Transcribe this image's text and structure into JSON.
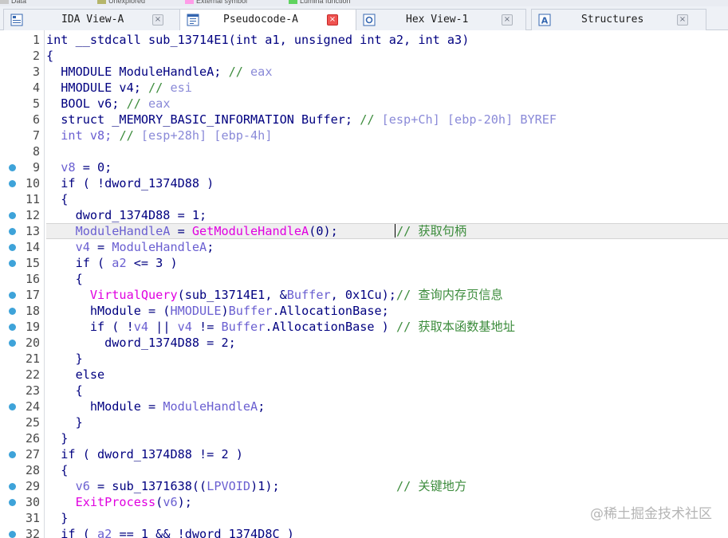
{
  "legend": [
    {
      "label": "Data",
      "color": "#c8c8c8"
    },
    {
      "label": "Unexplored",
      "color": "#b5b56a"
    },
    {
      "label": "External symbol",
      "color": "#ff9ce8"
    },
    {
      "label": "Lumina function",
      "color": "#5fd35f"
    }
  ],
  "tabs": [
    {
      "label": "IDA View-A",
      "icon": "graph-view-icon",
      "close": "×",
      "active": false
    },
    {
      "label": "Pseudocode-A",
      "icon": "pseudocode-icon",
      "close": "×",
      "active": true
    },
    {
      "label": "Hex View-1",
      "icon": "hex-view-icon",
      "close": "×",
      "active": false
    },
    {
      "label": "Structures",
      "icon": "structures-icon",
      "close": "×",
      "active": false
    }
  ],
  "code": [
    {
      "num": "1",
      "bp": false,
      "parts": [
        [
          "k",
          "int __stdcall sub_13714E1(int a1, unsigned int a2, int a3)"
        ]
      ]
    },
    {
      "num": "2",
      "bp": false,
      "parts": [
        [
          "k",
          "{"
        ]
      ]
    },
    {
      "num": "3",
      "bp": false,
      "parts": [
        [
          "k",
          "  HMODULE ModuleHandleA; "
        ],
        [
          "c",
          "// "
        ],
        [
          "cg",
          "eax"
        ]
      ]
    },
    {
      "num": "4",
      "bp": false,
      "parts": [
        [
          "k",
          "  HMODULE v4; "
        ],
        [
          "c",
          "// "
        ],
        [
          "cg",
          "esi"
        ]
      ]
    },
    {
      "num": "5",
      "bp": false,
      "parts": [
        [
          "k",
          "  BOOL v6; "
        ],
        [
          "c",
          "// "
        ],
        [
          "cg",
          "eax"
        ]
      ]
    },
    {
      "num": "6",
      "bp": false,
      "parts": [
        [
          "k",
          "  struct _MEMORY_BASIC_INFORMATION Buffer; "
        ],
        [
          "c",
          "// "
        ],
        [
          "cg",
          "[esp+Ch] [ebp-20h] BYREF"
        ]
      ]
    },
    {
      "num": "7",
      "bp": false,
      "parts": [
        [
          "v",
          "  int v8; "
        ],
        [
          "c",
          "// "
        ],
        [
          "cg",
          "[esp+28h] [ebp-4h]"
        ]
      ]
    },
    {
      "num": "8",
      "bp": false,
      "parts": [
        [
          "k",
          ""
        ]
      ]
    },
    {
      "num": "9",
      "bp": true,
      "parts": [
        [
          "k",
          "  "
        ],
        [
          "v",
          "v8"
        ],
        [
          "k",
          " = 0;"
        ]
      ]
    },
    {
      "num": "10",
      "bp": true,
      "parts": [
        [
          "k",
          "  if ( !dword_1374D88 )"
        ]
      ]
    },
    {
      "num": "11",
      "bp": false,
      "parts": [
        [
          "k",
          "  {"
        ]
      ]
    },
    {
      "num": "12",
      "bp": true,
      "parts": [
        [
          "k",
          "    dword_1374D88 = 1;"
        ]
      ]
    },
    {
      "num": "13",
      "bp": true,
      "hl": true,
      "parts": [
        [
          "v",
          "    ModuleHandleA"
        ],
        [
          "k",
          " = "
        ],
        [
          "f",
          "GetModuleHandleA"
        ],
        [
          "k",
          "(0);        "
        ],
        [
          "cursor",
          ""
        ],
        [
          "c",
          "// "
        ],
        [
          "ccjk",
          "获取句柄"
        ]
      ]
    },
    {
      "num": "14",
      "bp": true,
      "parts": [
        [
          "v",
          "    v4"
        ],
        [
          "k",
          " = "
        ],
        [
          "v",
          "ModuleHandleA"
        ],
        [
          "k",
          ";"
        ]
      ]
    },
    {
      "num": "15",
      "bp": true,
      "parts": [
        [
          "k",
          "    if ( "
        ],
        [
          "v",
          "a2"
        ],
        [
          "k",
          " <= 3 )"
        ]
      ]
    },
    {
      "num": "16",
      "bp": false,
      "parts": [
        [
          "k",
          "    {"
        ]
      ]
    },
    {
      "num": "17",
      "bp": true,
      "parts": [
        [
          "f",
          "      VirtualQuery"
        ],
        [
          "k",
          "(sub_13714E1, &"
        ],
        [
          "v",
          "Buffer"
        ],
        [
          "k",
          ", 0x1Cu);"
        ],
        [
          "c",
          "// "
        ],
        [
          "ccjk",
          "查询内存页信息"
        ]
      ]
    },
    {
      "num": "18",
      "bp": true,
      "parts": [
        [
          "k",
          "      hModule = ("
        ],
        [
          "v",
          "HMODULE"
        ],
        [
          "k",
          ")"
        ],
        [
          "v",
          "Buffer"
        ],
        [
          "k",
          ".AllocationBase;"
        ]
      ]
    },
    {
      "num": "19",
      "bp": true,
      "parts": [
        [
          "k",
          "      if ( !"
        ],
        [
          "v",
          "v4"
        ],
        [
          "k",
          " || "
        ],
        [
          "v",
          "v4"
        ],
        [
          "k",
          " != "
        ],
        [
          "v",
          "Buffer"
        ],
        [
          "k",
          ".AllocationBase ) "
        ],
        [
          "c",
          "// "
        ],
        [
          "ccjk",
          "获取本函数基地址"
        ]
      ]
    },
    {
      "num": "20",
      "bp": true,
      "parts": [
        [
          "k",
          "        dword_1374D88 = 2;"
        ]
      ]
    },
    {
      "num": "21",
      "bp": false,
      "parts": [
        [
          "k",
          "    }"
        ]
      ]
    },
    {
      "num": "22",
      "bp": false,
      "parts": [
        [
          "k",
          "    else"
        ]
      ]
    },
    {
      "num": "23",
      "bp": false,
      "parts": [
        [
          "k",
          "    {"
        ]
      ]
    },
    {
      "num": "24",
      "bp": true,
      "parts": [
        [
          "k",
          "      hModule = "
        ],
        [
          "v",
          "ModuleHandleA"
        ],
        [
          "k",
          ";"
        ]
      ]
    },
    {
      "num": "25",
      "bp": false,
      "parts": [
        [
          "k",
          "    }"
        ]
      ]
    },
    {
      "num": "26",
      "bp": false,
      "parts": [
        [
          "k",
          "  }"
        ]
      ]
    },
    {
      "num": "27",
      "bp": true,
      "parts": [
        [
          "k",
          "  if ( dword_1374D88 != 2 )"
        ]
      ]
    },
    {
      "num": "28",
      "bp": false,
      "parts": [
        [
          "k",
          "  {"
        ]
      ]
    },
    {
      "num": "29",
      "bp": true,
      "parts": [
        [
          "v",
          "    v6"
        ],
        [
          "k",
          " = sub_1371638(("
        ],
        [
          "v",
          "LPVOID"
        ],
        [
          "k",
          ")1);                "
        ],
        [
          "c",
          "// "
        ],
        [
          "ccjk",
          "关键地方"
        ]
      ]
    },
    {
      "num": "30",
      "bp": true,
      "parts": [
        [
          "f",
          "    ExitProcess"
        ],
        [
          "k",
          "("
        ],
        [
          "v",
          "v6"
        ],
        [
          "k",
          ");"
        ]
      ]
    },
    {
      "num": "31",
      "bp": false,
      "parts": [
        [
          "k",
          "  }"
        ]
      ]
    },
    {
      "num": "32",
      "bp": true,
      "parts": [
        [
          "k",
          "  if ( "
        ],
        [
          "v",
          "a2"
        ],
        [
          "k",
          " == 1 && !dword_1374D8C )"
        ]
      ]
    }
  ],
  "watermark": "@稀土掘金技术社区"
}
